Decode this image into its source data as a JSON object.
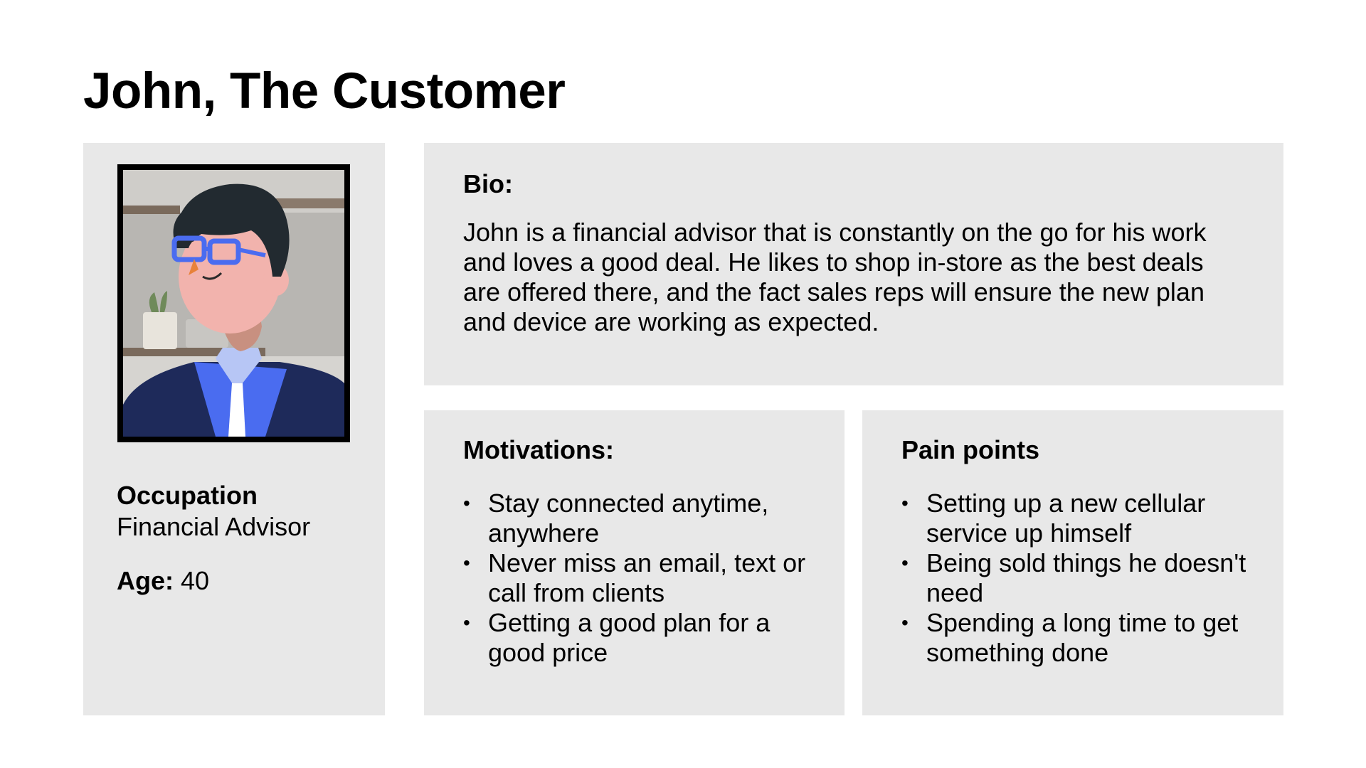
{
  "title": "John, The Customer",
  "profile": {
    "photo_description_icon": "avatar-illustration",
    "occupation_label": "Occupation",
    "occupation_value": "Financial Advisor",
    "age_label": "Age:",
    "age_value": "40"
  },
  "bio": {
    "heading": "Bio:",
    "text": "John is a financial advisor that is constantly on the go for his work and loves a good deal. He likes to shop in-store as the best deals are offered there, and the fact sales reps will ensure the new plan and device are working as expected."
  },
  "motivations": {
    "heading": "Motivations:",
    "items": [
      "Stay connected anytime, anywhere",
      "Never miss an email, text or call from clients",
      "Getting a good plan for a good price"
    ]
  },
  "pain_points": {
    "heading": "Pain points",
    "items": [
      "Setting up a new cellular service up himself",
      "Being sold things he doesn't need",
      "Spending a long time to get something done"
    ]
  },
  "colors": {
    "panel_bg": "#e8e8e8",
    "glasses": "#4a6cf0",
    "jacket": "#1e2a5a",
    "shirt": "#4a6cf0"
  }
}
